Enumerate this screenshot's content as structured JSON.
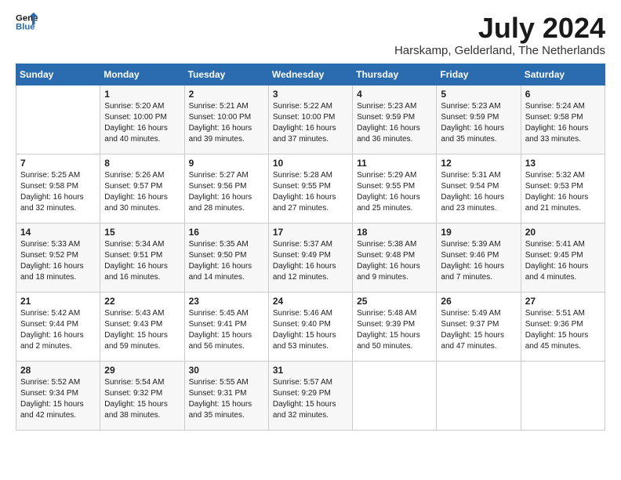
{
  "header": {
    "logo_line1": "General",
    "logo_line2": "Blue",
    "month_year": "July 2024",
    "location": "Harskamp, Gelderland, The Netherlands"
  },
  "weekdays": [
    "Sunday",
    "Monday",
    "Tuesday",
    "Wednesday",
    "Thursday",
    "Friday",
    "Saturday"
  ],
  "weeks": [
    [
      {
        "day": "",
        "info": ""
      },
      {
        "day": "1",
        "info": "Sunrise: 5:20 AM\nSunset: 10:00 PM\nDaylight: 16 hours\nand 40 minutes."
      },
      {
        "day": "2",
        "info": "Sunrise: 5:21 AM\nSunset: 10:00 PM\nDaylight: 16 hours\nand 39 minutes."
      },
      {
        "day": "3",
        "info": "Sunrise: 5:22 AM\nSunset: 10:00 PM\nDaylight: 16 hours\nand 37 minutes."
      },
      {
        "day": "4",
        "info": "Sunrise: 5:23 AM\nSunset: 9:59 PM\nDaylight: 16 hours\nand 36 minutes."
      },
      {
        "day": "5",
        "info": "Sunrise: 5:23 AM\nSunset: 9:59 PM\nDaylight: 16 hours\nand 35 minutes."
      },
      {
        "day": "6",
        "info": "Sunrise: 5:24 AM\nSunset: 9:58 PM\nDaylight: 16 hours\nand 33 minutes."
      }
    ],
    [
      {
        "day": "7",
        "info": "Sunrise: 5:25 AM\nSunset: 9:58 PM\nDaylight: 16 hours\nand 32 minutes."
      },
      {
        "day": "8",
        "info": "Sunrise: 5:26 AM\nSunset: 9:57 PM\nDaylight: 16 hours\nand 30 minutes."
      },
      {
        "day": "9",
        "info": "Sunrise: 5:27 AM\nSunset: 9:56 PM\nDaylight: 16 hours\nand 28 minutes."
      },
      {
        "day": "10",
        "info": "Sunrise: 5:28 AM\nSunset: 9:55 PM\nDaylight: 16 hours\nand 27 minutes."
      },
      {
        "day": "11",
        "info": "Sunrise: 5:29 AM\nSunset: 9:55 PM\nDaylight: 16 hours\nand 25 minutes."
      },
      {
        "day": "12",
        "info": "Sunrise: 5:31 AM\nSunset: 9:54 PM\nDaylight: 16 hours\nand 23 minutes."
      },
      {
        "day": "13",
        "info": "Sunrise: 5:32 AM\nSunset: 9:53 PM\nDaylight: 16 hours\nand 21 minutes."
      }
    ],
    [
      {
        "day": "14",
        "info": "Sunrise: 5:33 AM\nSunset: 9:52 PM\nDaylight: 16 hours\nand 18 minutes."
      },
      {
        "day": "15",
        "info": "Sunrise: 5:34 AM\nSunset: 9:51 PM\nDaylight: 16 hours\nand 16 minutes."
      },
      {
        "day": "16",
        "info": "Sunrise: 5:35 AM\nSunset: 9:50 PM\nDaylight: 16 hours\nand 14 minutes."
      },
      {
        "day": "17",
        "info": "Sunrise: 5:37 AM\nSunset: 9:49 PM\nDaylight: 16 hours\nand 12 minutes."
      },
      {
        "day": "18",
        "info": "Sunrise: 5:38 AM\nSunset: 9:48 PM\nDaylight: 16 hours\nand 9 minutes."
      },
      {
        "day": "19",
        "info": "Sunrise: 5:39 AM\nSunset: 9:46 PM\nDaylight: 16 hours\nand 7 minutes."
      },
      {
        "day": "20",
        "info": "Sunrise: 5:41 AM\nSunset: 9:45 PM\nDaylight: 16 hours\nand 4 minutes."
      }
    ],
    [
      {
        "day": "21",
        "info": "Sunrise: 5:42 AM\nSunset: 9:44 PM\nDaylight: 16 hours\nand 2 minutes."
      },
      {
        "day": "22",
        "info": "Sunrise: 5:43 AM\nSunset: 9:43 PM\nDaylight: 15 hours\nand 59 minutes."
      },
      {
        "day": "23",
        "info": "Sunrise: 5:45 AM\nSunset: 9:41 PM\nDaylight: 15 hours\nand 56 minutes."
      },
      {
        "day": "24",
        "info": "Sunrise: 5:46 AM\nSunset: 9:40 PM\nDaylight: 15 hours\nand 53 minutes."
      },
      {
        "day": "25",
        "info": "Sunrise: 5:48 AM\nSunset: 9:39 PM\nDaylight: 15 hours\nand 50 minutes."
      },
      {
        "day": "26",
        "info": "Sunrise: 5:49 AM\nSunset: 9:37 PM\nDaylight: 15 hours\nand 47 minutes."
      },
      {
        "day": "27",
        "info": "Sunrise: 5:51 AM\nSunset: 9:36 PM\nDaylight: 15 hours\nand 45 minutes."
      }
    ],
    [
      {
        "day": "28",
        "info": "Sunrise: 5:52 AM\nSunset: 9:34 PM\nDaylight: 15 hours\nand 42 minutes."
      },
      {
        "day": "29",
        "info": "Sunrise: 5:54 AM\nSunset: 9:32 PM\nDaylight: 15 hours\nand 38 minutes."
      },
      {
        "day": "30",
        "info": "Sunrise: 5:55 AM\nSunset: 9:31 PM\nDaylight: 15 hours\nand 35 minutes."
      },
      {
        "day": "31",
        "info": "Sunrise: 5:57 AM\nSunset: 9:29 PM\nDaylight: 15 hours\nand 32 minutes."
      },
      {
        "day": "",
        "info": ""
      },
      {
        "day": "",
        "info": ""
      },
      {
        "day": "",
        "info": ""
      }
    ]
  ]
}
